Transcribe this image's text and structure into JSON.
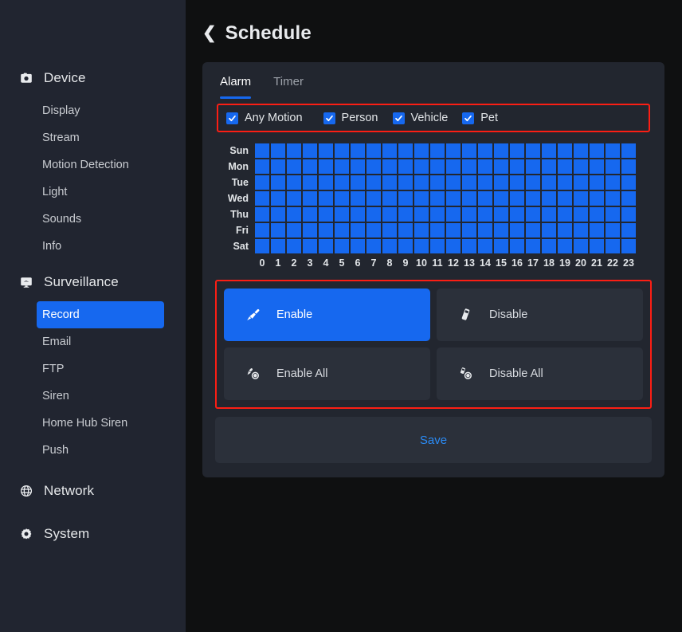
{
  "sidebar": {
    "groups": [
      {
        "icon": "camera-icon",
        "label": "Device",
        "items": [
          {
            "label": "Display",
            "active": false
          },
          {
            "label": "Stream",
            "active": false
          },
          {
            "label": "Motion Detection",
            "active": false
          },
          {
            "label": "Light",
            "active": false
          },
          {
            "label": "Sounds",
            "active": false
          },
          {
            "label": "Info",
            "active": false
          }
        ]
      },
      {
        "icon": "monitor-icon",
        "label": "Surveillance",
        "items": [
          {
            "label": "Record",
            "active": true
          },
          {
            "label": "Email",
            "active": false
          },
          {
            "label": "FTP",
            "active": false
          },
          {
            "label": "Siren",
            "active": false
          },
          {
            "label": "Home Hub Siren",
            "active": false
          },
          {
            "label": "Push",
            "active": false
          }
        ]
      },
      {
        "icon": "globe-icon",
        "label": "Network",
        "items": []
      },
      {
        "icon": "gear-icon",
        "label": "System",
        "items": []
      }
    ]
  },
  "header": {
    "back_icon": "chevron-left-icon",
    "title": "Schedule"
  },
  "tabs": [
    {
      "label": "Alarm",
      "active": true
    },
    {
      "label": "Timer",
      "active": false
    }
  ],
  "detection_filters": [
    {
      "label": "Any Motion",
      "checked": true
    },
    {
      "label": "Person",
      "checked": true
    },
    {
      "label": "Vehicle",
      "checked": true
    },
    {
      "label": "Pet",
      "checked": true
    }
  ],
  "schedule": {
    "days": [
      "Sun",
      "Mon",
      "Tue",
      "Wed",
      "Thu",
      "Fri",
      "Sat"
    ],
    "hours": [
      "0",
      "1",
      "2",
      "3",
      "4",
      "5",
      "6",
      "7",
      "8",
      "9",
      "10",
      "11",
      "12",
      "13",
      "14",
      "15",
      "16",
      "17",
      "18",
      "19",
      "20",
      "21",
      "22",
      "23"
    ],
    "cells": [
      [
        1,
        1,
        1,
        1,
        1,
        1,
        1,
        1,
        1,
        1,
        1,
        1,
        1,
        1,
        1,
        1,
        1,
        1,
        1,
        1,
        1,
        1,
        1,
        1
      ],
      [
        1,
        1,
        1,
        1,
        1,
        1,
        1,
        1,
        1,
        1,
        1,
        1,
        1,
        1,
        1,
        1,
        1,
        1,
        1,
        1,
        1,
        1,
        1,
        1
      ],
      [
        1,
        1,
        1,
        1,
        1,
        1,
        1,
        1,
        1,
        1,
        1,
        1,
        1,
        1,
        1,
        1,
        1,
        1,
        1,
        1,
        1,
        1,
        1,
        1
      ],
      [
        1,
        1,
        1,
        1,
        1,
        1,
        1,
        1,
        1,
        1,
        1,
        1,
        1,
        1,
        1,
        1,
        1,
        1,
        1,
        1,
        1,
        1,
        1,
        1
      ],
      [
        1,
        1,
        1,
        1,
        1,
        1,
        1,
        1,
        1,
        1,
        1,
        1,
        1,
        1,
        1,
        1,
        1,
        1,
        1,
        1,
        1,
        1,
        1,
        1
      ],
      [
        1,
        1,
        1,
        1,
        1,
        1,
        1,
        1,
        1,
        1,
        1,
        1,
        1,
        1,
        1,
        1,
        1,
        1,
        1,
        1,
        1,
        1,
        1,
        1
      ],
      [
        1,
        1,
        1,
        1,
        1,
        1,
        1,
        1,
        1,
        1,
        1,
        1,
        1,
        1,
        1,
        1,
        1,
        1,
        1,
        1,
        1,
        1,
        1,
        1
      ]
    ]
  },
  "actions": [
    {
      "label": "Enable",
      "icon": "brush-icon",
      "selected": true
    },
    {
      "label": "Disable",
      "icon": "eraser-icon",
      "selected": false
    },
    {
      "label": "Enable All",
      "icon": "brush-all-icon",
      "selected": false
    },
    {
      "label": "Disable All",
      "icon": "eraser-all-icon",
      "selected": false
    }
  ],
  "save": {
    "label": "Save"
  },
  "colors": {
    "accent": "#1668ef",
    "highlight_border": "#fb1e14",
    "panel_bg": "#22262f",
    "sidebar_bg": "#212530",
    "page_bg": "#0f1011",
    "save_text": "#2b8bf5"
  }
}
